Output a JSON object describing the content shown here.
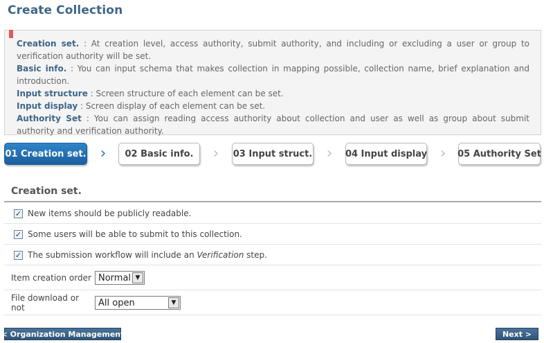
{
  "page": {
    "title": "Create Collection"
  },
  "info": {
    "items": [
      {
        "term": "Creation set.",
        "desc": " : At creation level, access authority, submit authority, and including or excluding a user or group to verification authority will be set."
      },
      {
        "term": "Basic info.",
        "desc": " : You can input schema that makes collection in mapping possible, collection name, brief explanation and introduction."
      },
      {
        "term": "Input structure",
        "desc": " : Screen structure of each element can be set."
      },
      {
        "term": "Input display",
        "desc": " : Screen display of each element can be set."
      },
      {
        "term": "Authority Set",
        "desc": " : You can assign reading access authority about collection and user as well as group about submit authority and verification authority."
      }
    ]
  },
  "steps": [
    {
      "label": "01 Creation set.",
      "active": true
    },
    {
      "label": "02 Basic info.",
      "active": false
    },
    {
      "label": "03 Input struct.",
      "active": false
    },
    {
      "label": "04 Input display",
      "active": false
    },
    {
      "label": "05 Authority Set",
      "active": false
    }
  ],
  "section": {
    "title": "Creation set."
  },
  "options": {
    "public_readable": {
      "label": "New items should be publicly readable.",
      "checked": true
    },
    "submit_users": {
      "label": "Some users will be able to submit to this collection.",
      "checked": true
    },
    "verification": {
      "label_before": "The submission workflow will include an ",
      "label_em": "Verification",
      "label_after": " step.",
      "checked": true
    }
  },
  "fields": {
    "creation_order": {
      "label": "Item creation order",
      "value": "Normal"
    },
    "file_download": {
      "label": "File download or not",
      "value": "All open"
    }
  },
  "buttons": {
    "back": "< Organization Management",
    "next": "Next >"
  },
  "icons": {
    "chevron": "chevron-right-icon",
    "checkbox": "checkmark-icon",
    "dropdown": "dropdown-arrow-icon"
  },
  "colors": {
    "title": "#3e6688",
    "active_step": "#2a73b8",
    "bookmark": "#e45a5a"
  }
}
